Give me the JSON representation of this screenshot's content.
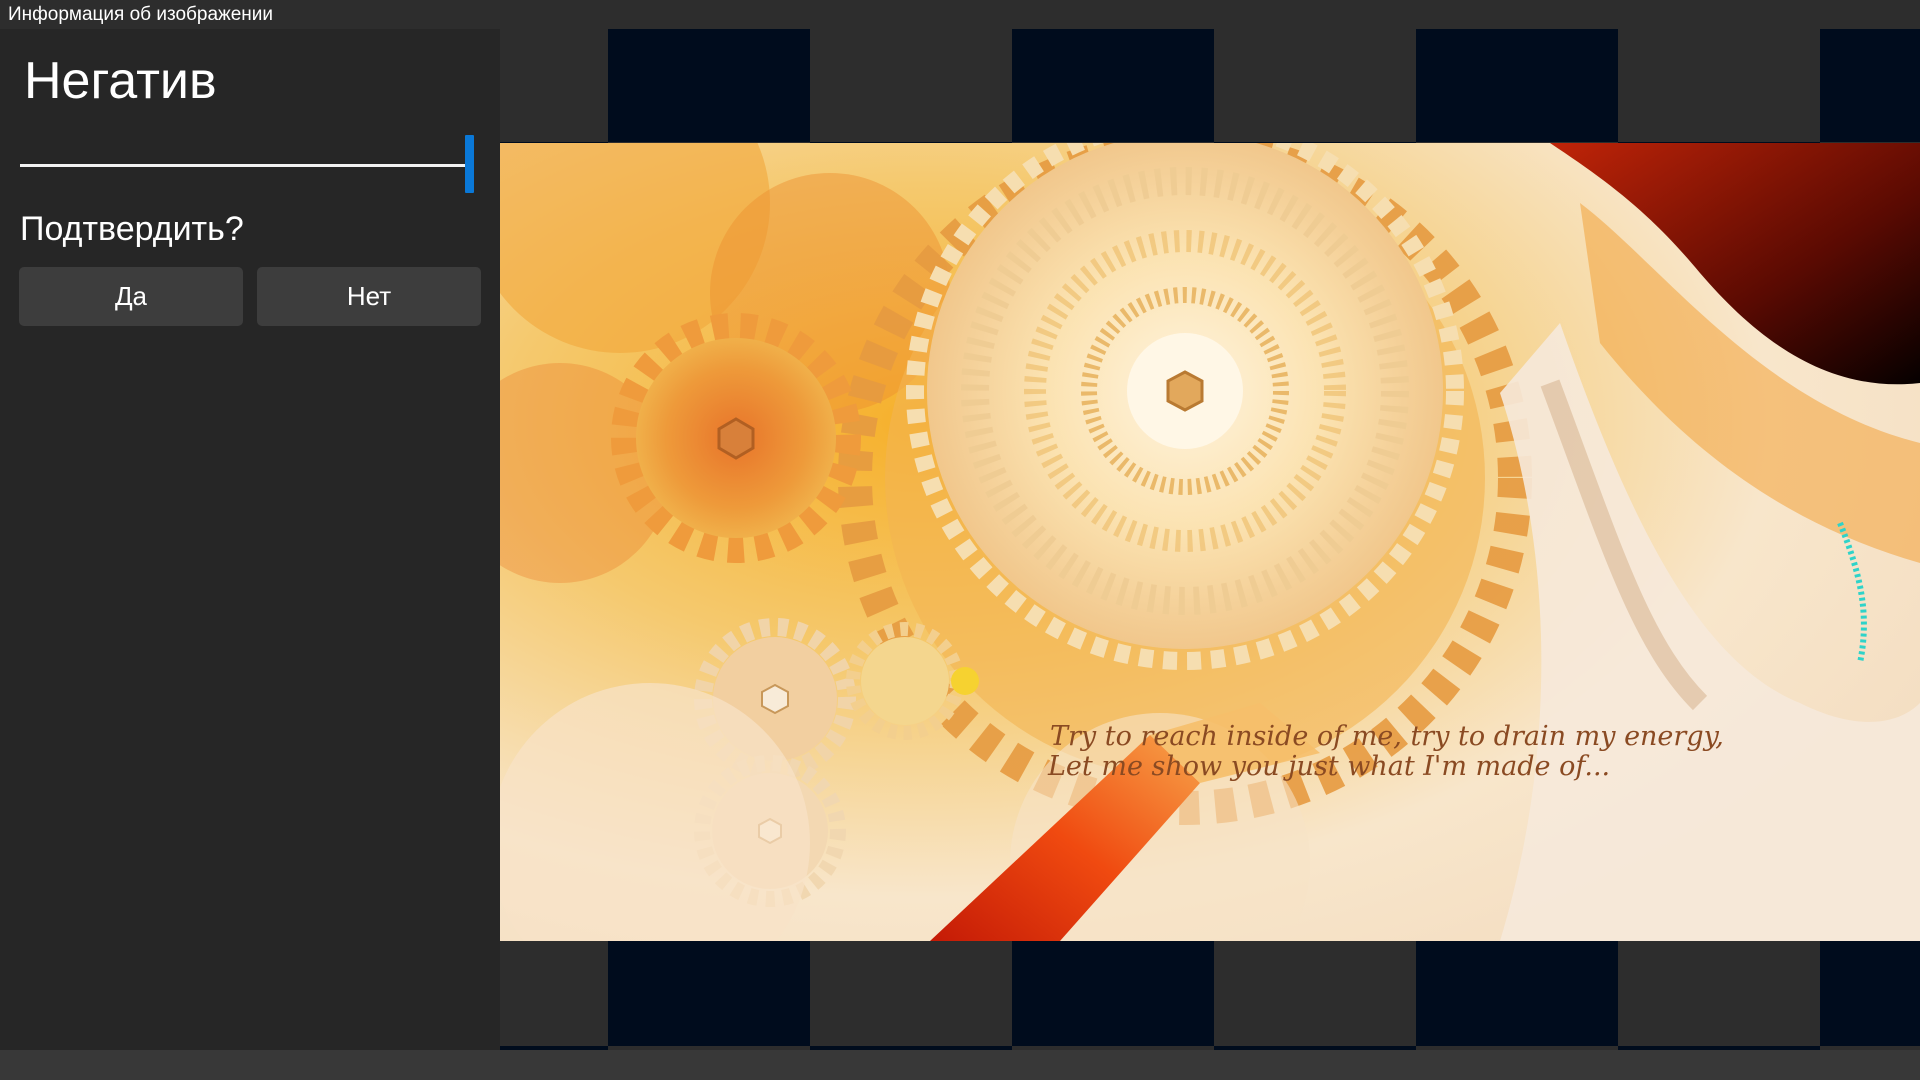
{
  "window": {
    "title": "Информация об изображении"
  },
  "panel": {
    "effect_name": "Негатив",
    "slider": {
      "value": 1.0
    },
    "confirm_prompt": "Подтвердить?",
    "yes_label": "Да",
    "no_label": "Нет"
  },
  "preview": {
    "quote_line1": "Try to reach inside of me, try to drain my energy,",
    "quote_line2": "Let me show you just what I'm made of..."
  },
  "colors": {
    "accent": "#0a78d7",
    "panel_bg": "#262626",
    "button_bg": "#3d3d3d",
    "checker_dark": "#000c1d",
    "checker_light": "#2d2d2d"
  }
}
